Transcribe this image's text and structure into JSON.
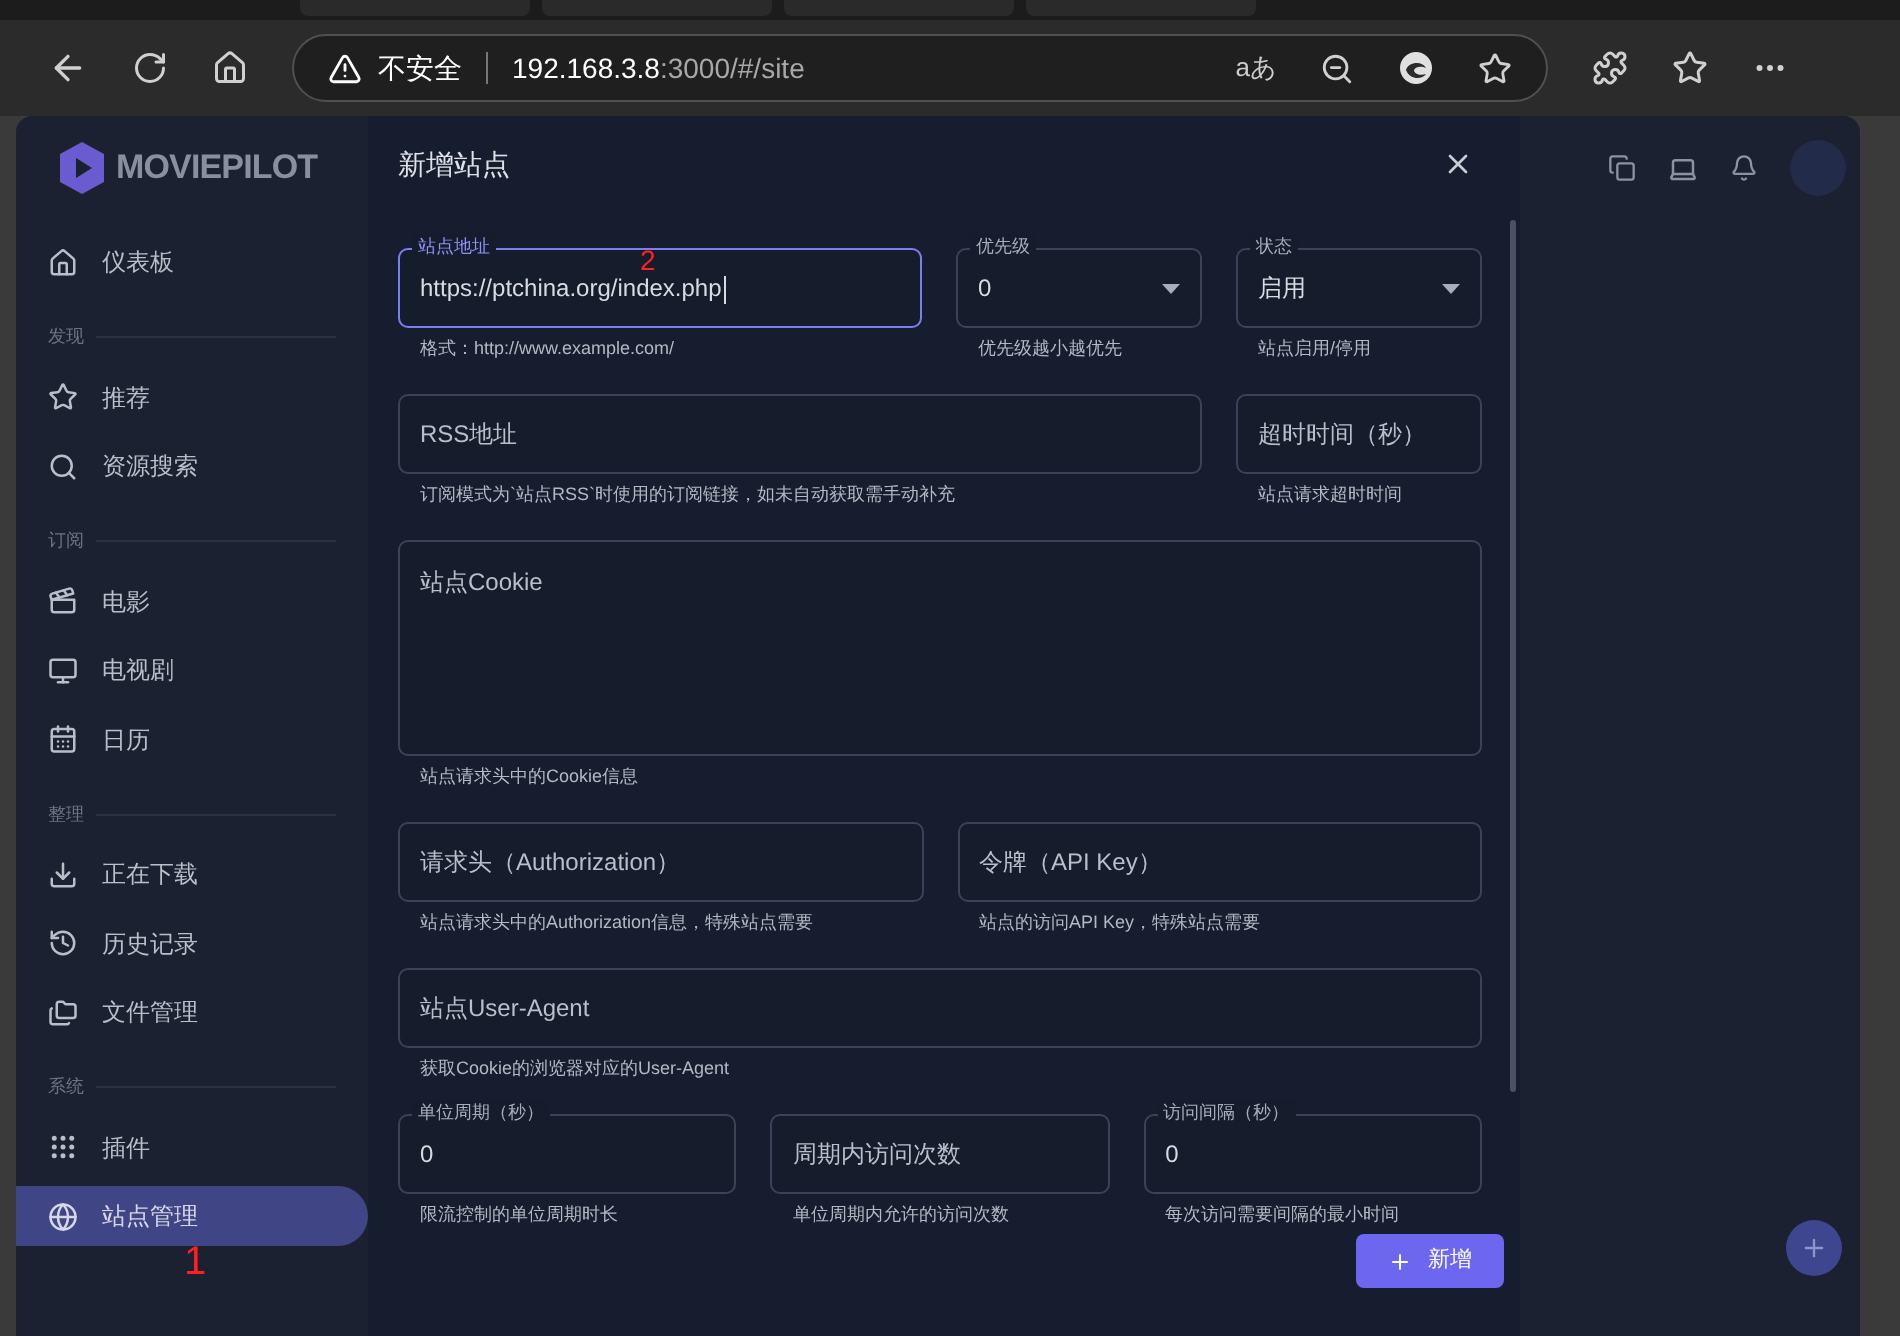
{
  "browser": {
    "security_label": "不安全",
    "url_host": "192.168.3.8",
    "url_rest": ":3000/#/site",
    "read_aloud": "aあ"
  },
  "sidebar": {
    "logo": "MOVIEPILOT",
    "sections": [
      {
        "items": [
          {
            "label": "仪表板",
            "selected": false
          }
        ]
      },
      {
        "title": "发现",
        "items": [
          {
            "label": "推荐",
            "selected": false
          },
          {
            "label": "资源搜索",
            "selected": false
          }
        ]
      },
      {
        "title": "订阅",
        "items": [
          {
            "label": "电影",
            "selected": false
          },
          {
            "label": "电视剧",
            "selected": false
          },
          {
            "label": "日历",
            "selected": false
          }
        ]
      },
      {
        "title": "整理",
        "items": [
          {
            "label": "正在下载",
            "selected": false
          },
          {
            "label": "历史记录",
            "selected": false
          },
          {
            "label": "文件管理",
            "selected": false
          }
        ]
      },
      {
        "title": "系统",
        "items": [
          {
            "label": "插件",
            "selected": false
          },
          {
            "label": "站点管理",
            "selected": true
          }
        ]
      }
    ]
  },
  "dialog": {
    "title": "新增站点",
    "fields": [
      {
        "kind": "text",
        "label": "站点地址",
        "value": "https://ptchina.org/index.php",
        "focused": true,
        "hint": "格式：http://www.example.com/"
      },
      {
        "kind": "select",
        "label": "优先级",
        "value": "0",
        "focused": false,
        "hint": "优先级越小越优先"
      },
      {
        "kind": "select",
        "label": "状态",
        "value": "启用",
        "focused": false,
        "hint": "站点启用/停用"
      },
      {
        "kind": "text",
        "placeholder": "RSS地址",
        "focused": false,
        "hint": "订阅模式为`站点RSS`时使用的订阅链接，如未自动获取需手动补充"
      },
      {
        "kind": "text",
        "placeholder": "超时时间（秒）",
        "focused": false,
        "hint": "站点请求超时时间"
      },
      {
        "kind": "textarea",
        "placeholder": "站点Cookie",
        "focused": false,
        "hint": "站点请求头中的Cookie信息"
      },
      {
        "kind": "text",
        "placeholder": "请求头（Authorization）",
        "focused": false,
        "hint": "站点请求头中的Authorization信息，特殊站点需要"
      },
      {
        "kind": "text",
        "placeholder": "令牌（API Key）",
        "focused": false,
        "hint": "站点的访问API Key，特殊站点需要"
      },
      {
        "kind": "text",
        "placeholder": "站点User-Agent",
        "focused": false,
        "hint": "获取Cookie的浏览器对应的User-Agent"
      },
      {
        "kind": "text",
        "label": "单位周期（秒）",
        "value": "0",
        "focused": false,
        "hint": "限流控制的单位周期时长"
      },
      {
        "kind": "text",
        "placeholder": "周期内访问次数",
        "focused": false,
        "hint": "单位周期内允许的访问次数"
      },
      {
        "kind": "text",
        "label": "访问间隔（秒）",
        "value": "0",
        "focused": false,
        "hint": "每次访问需要间隔的最小时间"
      }
    ],
    "submit": "新增"
  },
  "annotations": [
    {
      "text": "1"
    },
    {
      "text": "2"
    }
  ]
}
